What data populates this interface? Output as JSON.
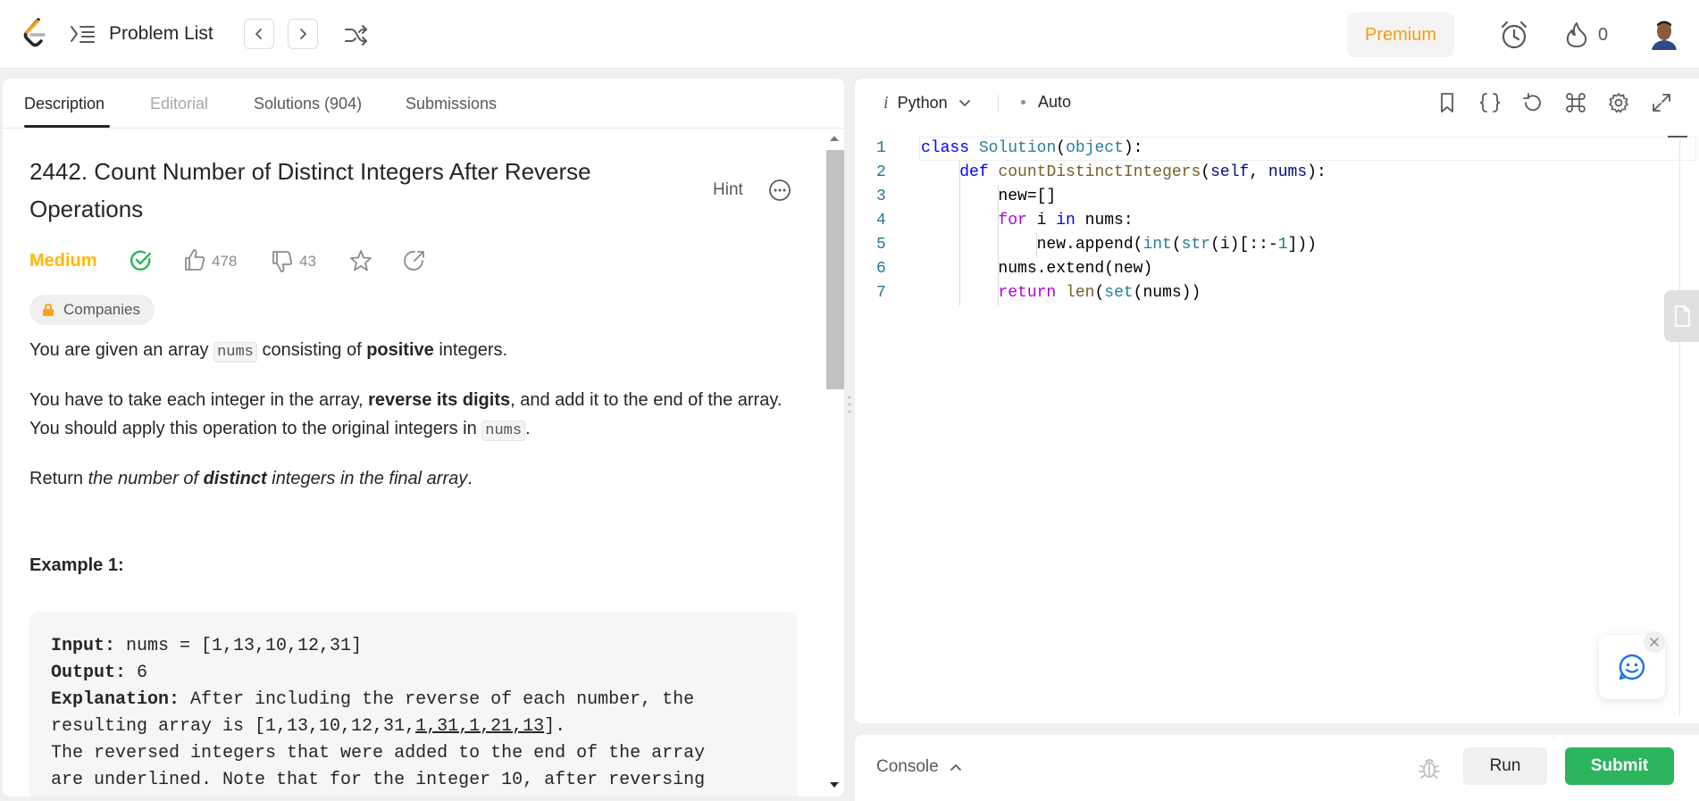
{
  "nav": {
    "problem_list_label": "Problem List",
    "premium_label": "Premium",
    "streak_count": "0"
  },
  "tabs": [
    {
      "label": "Description"
    },
    {
      "label": "Editorial"
    },
    {
      "label": "Solutions (904)"
    },
    {
      "label": "Submissions"
    }
  ],
  "problem": {
    "title": "2442. Count Number of Distinct Integers After Reverse Operations",
    "hint_label": "Hint",
    "difficulty": "Medium",
    "likes": "478",
    "dislikes": "43",
    "companies_label": "Companies",
    "p1": {
      "a": "You are given an array ",
      "code": "nums",
      "b": " consisting of ",
      "bold": "positive",
      "c": " integers."
    },
    "p2": {
      "a": "You have to take each integer in the array, ",
      "bold": "reverse its digits",
      "b": ", and add it to the end of the array. You should apply this operation to the original integers in ",
      "code": "nums",
      "c": "."
    },
    "p3": {
      "a": "Return ",
      "i1": "the number of ",
      "ib": "distinct",
      "i2": " integers in the final array",
      "c": "."
    },
    "example_title": "Example 1:",
    "example": {
      "input_label": "Input:",
      "input_value": " nums = [1,13,10,12,31]",
      "output_label": "Output:",
      "output_value": " 6",
      "explanation_label": "Explanation:",
      "explanation_1": " After including the reverse of each number, the",
      "explanation_2a": "resulting array is [1,13,10,12,31,",
      "explanation_2u": "1,31,1,21,13",
      "explanation_2b": "].",
      "explanation_3": "The reversed integers that were added to the end of the array",
      "explanation_4": "are underlined. Note that for the integer 10, after reversing"
    }
  },
  "editor": {
    "language": "Python",
    "language_prefix": "i",
    "mode": "Auto",
    "line_numbers": [
      "1",
      "2",
      "3",
      "4",
      "5",
      "6",
      "7"
    ]
  },
  "console": {
    "label": "Console",
    "run_label": "Run",
    "submit_label": "Submit"
  },
  "colors": {
    "premium": "#f59e0b",
    "medium": "#ffb800",
    "submit": "#2db55d",
    "solved": "#2db55d"
  }
}
